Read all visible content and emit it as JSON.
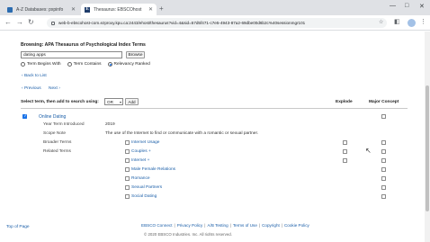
{
  "browser": {
    "tabs": [
      {
        "label": "A-Z Databases: pxpinfo",
        "active": false
      },
      {
        "label": "Thesaurus: EBSCOhost",
        "active": true
      }
    ],
    "new_tab": "+",
    "url": "web-b-ebscohost-com.ezproxy.kpu.ca:2443/ehost/thesaurus?vid=4&sid=57d5f471-c7e5-4943-87a2-69dbe00d6b2c%40sessionmgr101",
    "window_controls": {
      "minimize": "—",
      "maximize": "□",
      "close": "✕"
    }
  },
  "page": {
    "browsing_title": "Browsing: APA Thesaurus of Psychological Index Terms",
    "search_value": "dating apps",
    "browse_button": "Browse",
    "radio_options": [
      {
        "label": "Term Begins With",
        "checked": false
      },
      {
        "label": "Term Contains",
        "checked": false
      },
      {
        "label": "Relevancy Ranked",
        "checked": true
      }
    ],
    "back_link": "Back to List",
    "prev_link": "Previous",
    "next_link": "Next",
    "select_label": "Select term, then add to search using:",
    "operator_value": "OR",
    "add_button": "Add",
    "col_explode": "Explode",
    "col_major": "Major Concept",
    "term": {
      "name": "Online Dating",
      "checked": true,
      "year_label": "Year Term Introduced",
      "year_value": "2019",
      "scope_label": "Scope Note",
      "scope_value": "The use of the Internet to find or communicate with a romantic or sexual partner.",
      "broader_label": "Broader Terms",
      "related_label": "Related Terms",
      "broader_terms": [
        {
          "label": "Internet Usage",
          "has_explode": true
        }
      ],
      "related_terms": [
        {
          "label": "Couples",
          "plus": "+",
          "has_explode": true
        },
        {
          "label": "Internet",
          "plus": "+",
          "has_explode": true
        },
        {
          "label": "Male Female Relations",
          "plus": "",
          "has_explode": false
        },
        {
          "label": "Romance",
          "plus": "",
          "has_explode": false
        },
        {
          "label": "Sexual Partners",
          "plus": "",
          "has_explode": false
        },
        {
          "label": "Social Dating",
          "plus": "",
          "has_explode": false
        }
      ]
    },
    "footer": {
      "top_of_page": "Top of Page",
      "links": [
        "EBSCO Connect",
        "Privacy Policy",
        "A/B Testing",
        "Terms of Use",
        "Copyright",
        "Cookie Policy"
      ],
      "copyright": "© 2020 EBSCO Industries, Inc. All rights reserved."
    }
  }
}
